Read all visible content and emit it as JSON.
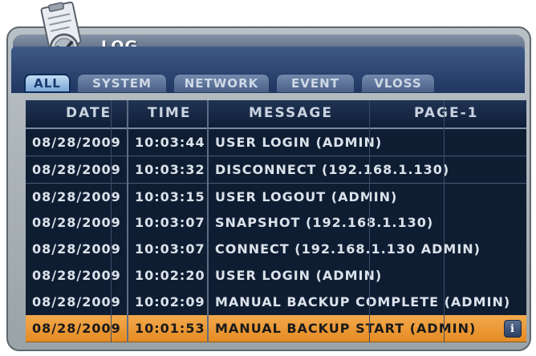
{
  "window": {
    "title": "LOG"
  },
  "tabs": [
    {
      "label": "ALL",
      "active": true
    },
    {
      "label": "SYSTEM",
      "active": false
    },
    {
      "label": "NETWORK",
      "active": false
    },
    {
      "label": "EVENT",
      "active": false
    },
    {
      "label": "VLOSS",
      "active": false
    }
  ],
  "table": {
    "headers": {
      "date": "DATE",
      "time": "TIME",
      "message": "MESSAGE",
      "page": "PAGE-1"
    },
    "rows": [
      {
        "date": "08/28/2009",
        "time": "10:03:44",
        "message": "USER LOGIN (ADMIN)"
      },
      {
        "date": "08/28/2009",
        "time": "10:03:32",
        "message": "DISCONNECT (192.168.1.130)"
      },
      {
        "date": "08/28/2009",
        "time": "10:03:15",
        "message": "USER LOGOUT (ADMIN)"
      },
      {
        "date": "08/28/2009",
        "time": "10:03:07",
        "message": "SNAPSHOT (192.168.1.130)"
      },
      {
        "date": "08/28/2009",
        "time": "10:03:07",
        "message": "CONNECT (192.168.1.130 ADMIN)"
      },
      {
        "date": "08/28/2009",
        "time": "10:02:20",
        "message": "USER LOGIN (ADMIN)"
      },
      {
        "date": "08/28/2009",
        "time": "10:02:09",
        "message": "MANUAL BACKUP COMPLETE (ADMIN)"
      },
      {
        "date": "08/28/2009",
        "time": "10:01:53",
        "message": "MANUAL BACKUP START (ADMIN)",
        "selected": true
      }
    ],
    "info_icon": "info-icon"
  },
  "colors": {
    "selected_row": "#e58b23",
    "table_bg": "#0f1d33",
    "active_tab": "#7aa6d6"
  }
}
